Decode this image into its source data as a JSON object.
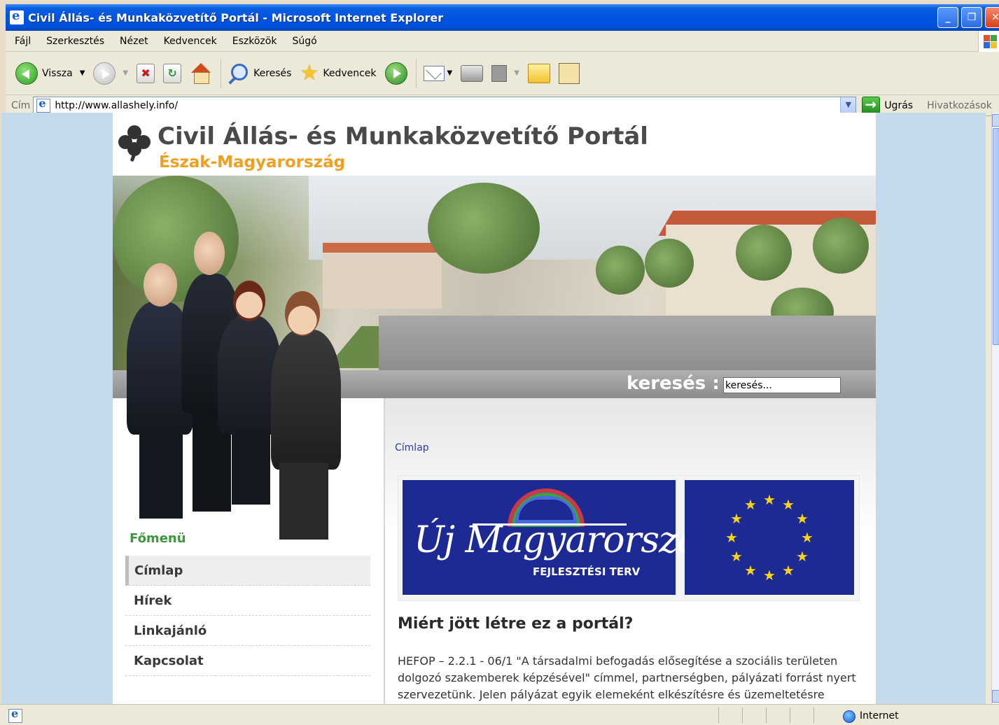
{
  "window": {
    "title": "Civil Állás- és Munkaközvetítő Portál - Microsoft Internet Explorer"
  },
  "menu": [
    "Fájl",
    "Szerkesztés",
    "Nézet",
    "Kedvencek",
    "Eszközök",
    "Súgó"
  ],
  "toolbar": {
    "back_label": "Vissza",
    "search_label": "Keresés",
    "favorites_label": "Kedvencek"
  },
  "address": {
    "label": "Cím",
    "url": "http://www.allashely.info/",
    "go_label": "Ugrás",
    "links_label": "Hivatkozások"
  },
  "site": {
    "title": "Civil Állás- és Munkaközvetítő Portál",
    "subtitle": "Észak-Magyarország",
    "search_label": "keresés :",
    "search_value": "keresés...",
    "main_menu_title": "Főmenü",
    "menu_items": [
      "Címlap",
      "Hírek",
      "Linkajánló",
      "Kapcsolat"
    ],
    "breadcrumb": "Címlap",
    "logo_umft_title": "Új Magyarország",
    "logo_umft_sub": "FEJLESZTÉSI TERV",
    "article_title": "Miért jött létre ez a portál?",
    "article_lines": [
      "HEFOP – 2.2.1 - 06/1 \"A társadalmi befogadás elősegítése a szociális területen",
      "dolgozó szakemberek képzésével\" címmel, partnerségben, pályázati forrást nyert",
      "szervezetünk. Jelen pályázat egyik elemeként elkészítésre és üzemeltetésre"
    ]
  },
  "status": {
    "zone": "Internet"
  }
}
